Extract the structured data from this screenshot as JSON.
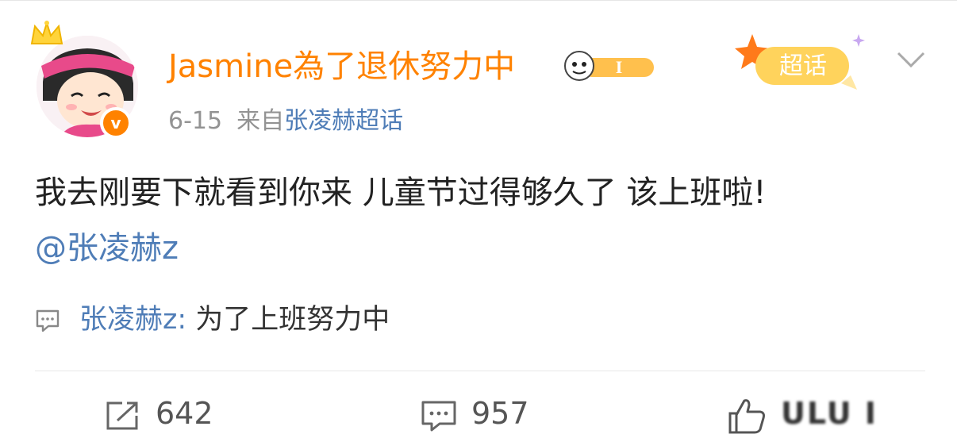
{
  "post": {
    "username": "Jasmine為了退休努力中",
    "verified_mark": "v",
    "date": "6-15",
    "source_prefix": "来自",
    "source_name": "张凌赫超话",
    "supertopic_label": "超话",
    "user_badge_label": "I",
    "text": "我去刚要下就看到你来 儿童节过得够久了 该上班啦!",
    "mention": "@张凌赫z"
  },
  "top_comment": {
    "user": "张凌赫z:",
    "text": " 为了上班努力中"
  },
  "actions": {
    "repost_count": "642",
    "comment_count": "957",
    "like_count": "ULU I"
  },
  "icons": {
    "crown": "crown-icon",
    "verified": "verified-badge-icon",
    "supertopic": "supertopic-star-icon",
    "chevron": "chevron-down-icon",
    "comment": "comment-icon",
    "repost": "repost-icon",
    "like": "thumbs-up-icon"
  },
  "colors": {
    "username": "#ff8200",
    "link": "#4f7db7",
    "meta": "#939393",
    "text": "#222222"
  }
}
